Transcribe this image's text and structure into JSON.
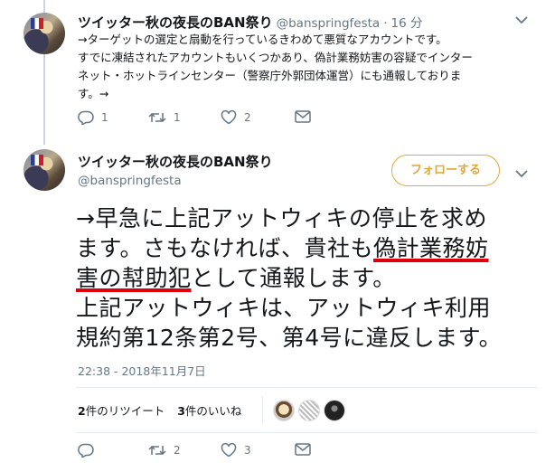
{
  "colors": {
    "accent": "#e0a83a",
    "text_secondary": "#657786",
    "underline_red": "#e0000b",
    "divider": "#e6ecf0"
  },
  "first_tweet": {
    "display_name": "ツイッター秋の夜長のBAN祭り",
    "handle": "@banspringfesta",
    "time_separator": "·",
    "time": "16 分",
    "lines": [
      "→ターゲットの選定と扇動を行っているきわめて悪質なアカウントです。",
      "すでに凍結されたアカウントもいくつかあり、偽計業務妨害の容疑でインター",
      "ネット・ホットラインセンター（警察庁外郭団体運営）にも通報しておりま",
      "す。→"
    ],
    "actions": {
      "reply_icon": "reply-icon",
      "reply_count": "1",
      "retweet_icon": "retweet-icon",
      "retweet_count": "1",
      "like_icon": "heart-icon",
      "like_count": "2",
      "dm_icon": "envelope-icon"
    }
  },
  "main_tweet": {
    "display_name": "ツイッター秋の夜長のBAN祭り",
    "handle": "@banspringfesta",
    "follow_label": "フォローする",
    "text": {
      "line1": "→早急に上記アットウィキの停止を求め",
      "line2_a": "ます。さもなければ、貴社も",
      "line2_b": "偽計業務妨",
      "line3_a": "害の幇助犯",
      "line3_b": "として通報します。",
      "line4": "上記アットウィキは、アットウィキ利用",
      "line5": "規約第12条第2号、第4号に違反します。"
    },
    "timestamp": "22:38 - 2018年11月7日",
    "stats": {
      "retweet_count": "2",
      "retweet_label": "件のリツイート",
      "like_count": "3",
      "like_label": "件のいいね"
    },
    "actions": {
      "reply_icon": "reply-icon",
      "reply_count": "",
      "retweet_icon": "retweet-icon",
      "retweet_count": "2",
      "like_icon": "heart-icon",
      "like_count": "3",
      "dm_icon": "envelope-icon"
    }
  }
}
